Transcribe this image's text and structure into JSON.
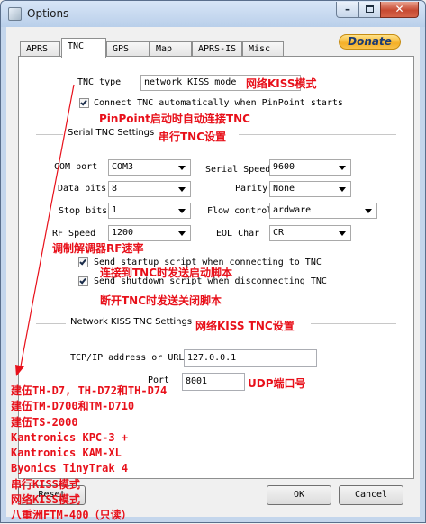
{
  "window": {
    "title": "Options"
  },
  "tabs": [
    {
      "label": "APRS",
      "active": false
    },
    {
      "label": "TNC",
      "active": true
    },
    {
      "label": "GPS",
      "active": false
    },
    {
      "label": "Map",
      "active": false
    },
    {
      "label": "APRS-IS",
      "active": false
    },
    {
      "label": "Misc",
      "active": false
    }
  ],
  "donate_label": "Donate",
  "tnc": {
    "type_label": "TNC type",
    "type_value": "network KISS mode",
    "auto_connect_label": "Connect TNC automatically when PinPoint starts",
    "auto_connect_checked": true
  },
  "serial": {
    "group_label": "Serial TNC Settings",
    "com_port_label": "COM port",
    "com_port_value": "COM3",
    "serial_speed_label": "Serial Speed",
    "serial_speed_value": "9600",
    "data_bits_label": "Data bits",
    "data_bits_value": "8",
    "parity_label": "Parity",
    "parity_value": "None",
    "stop_bits_label": "Stop bits",
    "stop_bits_value": "1",
    "flow_control_label": "Flow control",
    "flow_control_value": "ardware",
    "rf_speed_label": "RF Speed",
    "rf_speed_value": "1200",
    "eol_char_label": "EOL Char",
    "eol_char_value": "CR",
    "startup_script_label": "Send startup script when connecting to TNC",
    "startup_script_checked": true,
    "shutdown_script_label": "Send shutdown script when disconnecting TNC",
    "shutdown_script_checked": true
  },
  "network": {
    "group_label": "Network KISS TNC Settings",
    "tcpip_label": "TCP/IP address or URL",
    "tcpip_value": "127.0.0.1",
    "port_label": "Port",
    "port_value": "8001"
  },
  "buttons": {
    "reset": "Reset",
    "ok": "OK",
    "cancel": "Cancel"
  },
  "annotations": {
    "tnc_type": "网络KISS模式",
    "auto_connect": "PinPoint启动时自动连接TNC",
    "serial_group": "串行TNC设置",
    "rf_speed": "调制解调器RF速率",
    "startup_script": "连接到TNC时发送启动脚本",
    "shutdown_script": "断开TNC时发送关闭脚本",
    "network_group": "网络KISS TNC设置",
    "port": "UDP端口号",
    "type_options": [
      "建伍TH-D7, TH-D72和TH-D74",
      "建伍TM-D700和TM-D710",
      "建伍TS-2000",
      "Kantronics KPC-3 +",
      "Kantronics KAM-XL",
      "Byonics TinyTrak 4",
      "串行KISS模式",
      "网络KISS模式",
      "八重洲FTM-400（只读）"
    ]
  },
  "colors": {
    "annotation": "#e8101a",
    "donate": "#f5b027",
    "titlebar": "#c4d6ec"
  }
}
